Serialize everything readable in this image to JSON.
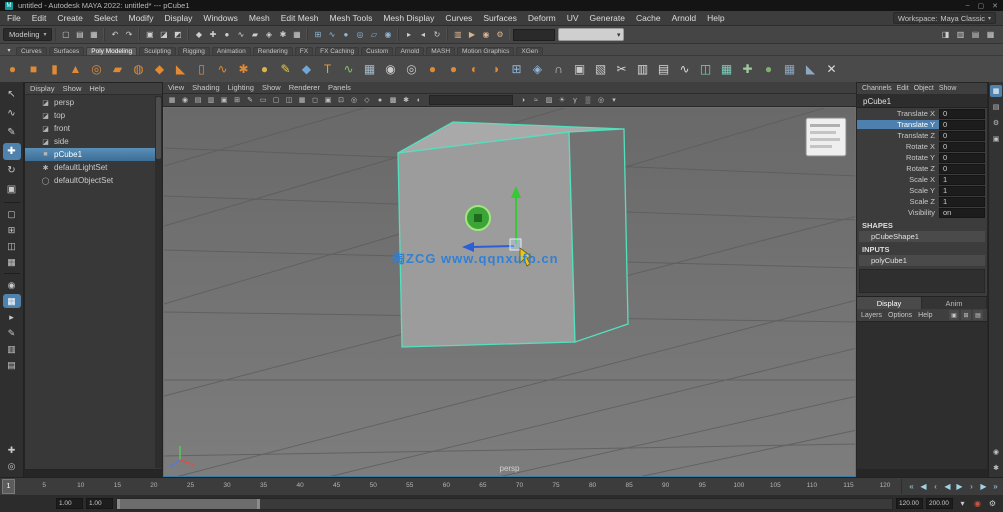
{
  "titlebar": {
    "title": "untitled - Autodesk MAYA 2022: untitled* --- pCube1",
    "controls": [
      {
        "n": "minimize-button",
        "g": "–"
      },
      {
        "n": "maximize-button",
        "g": "▢"
      },
      {
        "n": "close-button",
        "g": "✕"
      }
    ]
  },
  "menubar": {
    "items": [
      "File",
      "Edit",
      "Create",
      "Select",
      "Modify",
      "Display",
      "Windows",
      "Mesh",
      "Edit Mesh",
      "Mesh Tools",
      "Mesh Display",
      "Curves",
      "Surfaces",
      "Deform",
      "UV",
      "Generate",
      "Cache",
      "Arnold",
      "Help"
    ],
    "workspace_label": "Workspace:",
    "workspace_value": "Maya Classic"
  },
  "statusline": {
    "menuset": "Modeling",
    "groups": [
      {
        "icons": [
          {
            "n": "new-scene-icon",
            "g": "▢"
          },
          {
            "n": "open-scene-icon",
            "g": "▤"
          },
          {
            "n": "save-scene-icon",
            "g": "▦"
          }
        ]
      },
      {
        "icons": [
          {
            "n": "undo-icon",
            "g": "↶"
          },
          {
            "n": "redo-icon",
            "g": "↷"
          }
        ]
      },
      {
        "icons": [
          {
            "n": "hierarchy-mode-icon",
            "g": "▣"
          },
          {
            "n": "object-mode-icon",
            "g": "◪"
          },
          {
            "n": "component-mode-icon",
            "g": "◩"
          }
        ]
      },
      {
        "icons": [
          {
            "n": "select-all-mask-icon",
            "g": "◆"
          },
          {
            "n": "select-handles-mask-icon",
            "g": "✚"
          },
          {
            "n": "select-joints-mask-icon",
            "g": "●"
          },
          {
            "n": "select-curves-mask-icon",
            "g": "∿"
          },
          {
            "n": "select-surfaces-mask-icon",
            "g": "▰"
          },
          {
            "n": "select-deformations-mask-icon",
            "g": "◈"
          },
          {
            "n": "select-dynamics-mask-icon",
            "g": "✱"
          },
          {
            "n": "select-rendering-mask-icon",
            "g": "▦"
          }
        ]
      },
      {
        "icons": [
          {
            "n": "snap-grid-icon",
            "g": "⊞",
            "c": "#8fb8d8"
          },
          {
            "n": "snap-curve-icon",
            "g": "∿",
            "c": "#8fb8d8"
          },
          {
            "n": "snap-point-icon",
            "g": "●",
            "c": "#8fb8d8"
          },
          {
            "n": "snap-projected-center-icon",
            "g": "◎",
            "c": "#8fb8d8"
          },
          {
            "n": "snap-view-plane-icon",
            "g": "▱",
            "c": "#8fb8d8"
          },
          {
            "n": "make-live-icon",
            "g": "◉",
            "c": "#8fb8d8"
          }
        ]
      },
      {
        "icons": [
          {
            "n": "input-connections-icon",
            "g": "▸"
          },
          {
            "n": "output-connections-icon",
            "g": "◂"
          },
          {
            "n": "construction-history-icon",
            "g": "↻"
          }
        ]
      },
      {
        "icons": [
          {
            "n": "open-render-view-icon",
            "g": "▥",
            "c": "#d8b48f"
          },
          {
            "n": "render-current-frame-icon",
            "g": "▶",
            "c": "#d8b48f"
          },
          {
            "n": "ipr-render-icon",
            "g": "◉",
            "c": "#d8b48f"
          },
          {
            "n": "render-settings-icon",
            "g": "⚙",
            "c": "#d8b48f"
          }
        ]
      }
    ],
    "field_value": "",
    "toggles": [
      {
        "n": "modeling-toolkit-toggle-icon",
        "g": "◨"
      },
      {
        "n": "attribute-editor-toggle-icon",
        "g": "▥"
      },
      {
        "n": "tool-settings-toggle-icon",
        "g": "▤"
      },
      {
        "n": "channel-box-toggle-icon",
        "g": "▦"
      }
    ]
  },
  "shelf": {
    "tabs": [
      "Curves",
      "Surfaces",
      "Poly Modeling",
      "Sculpting",
      "Rigging",
      "Animation",
      "Rendering",
      "FX",
      "FX Caching",
      "Custom",
      "Arnold",
      "MASH",
      "Motion Graphics",
      "XGen"
    ],
    "active_tab": "Poly Modeling",
    "icons": [
      {
        "n": "poly-sphere-icon",
        "g": "●",
        "c": "#e08a35"
      },
      {
        "n": "poly-cube-icon",
        "g": "■",
        "c": "#e08a35"
      },
      {
        "n": "poly-cylinder-icon",
        "g": "▮",
        "c": "#e08a35"
      },
      {
        "n": "poly-cone-icon",
        "g": "▲",
        "c": "#e08a35"
      },
      {
        "n": "poly-torus-icon",
        "g": "◎",
        "c": "#e08a35"
      },
      {
        "n": "poly-plane-icon",
        "g": "▰",
        "c": "#e08a35"
      },
      {
        "n": "poly-disc-icon",
        "g": "◍",
        "c": "#e08a35"
      },
      {
        "n": "poly-platonic-icon",
        "g": "◆",
        "c": "#e08a35"
      },
      {
        "n": "poly-pyramid-icon",
        "g": "◣",
        "c": "#e08a35"
      },
      {
        "n": "poly-pipe-icon",
        "g": "▯",
        "c": "#e08a35"
      },
      {
        "n": "poly-helix-icon",
        "g": "∿",
        "c": "#e08a35"
      },
      {
        "n": "poly-gear-icon",
        "g": "✱",
        "c": "#e08a35"
      },
      {
        "n": "poly-soccerball-icon",
        "g": "●",
        "c": "#d8b44a"
      },
      {
        "n": "sculpt-pencil-icon",
        "g": "✎",
        "c": "#e5c94e"
      },
      {
        "n": "quad-draw-icon",
        "g": "◆",
        "c": "#6fa8d8"
      },
      {
        "n": "create-text-icon",
        "g": "T",
        "c": "#e0a040"
      },
      {
        "n": "sweep-mesh-icon",
        "g": "∿",
        "c": "#84c46a"
      },
      {
        "n": "uv-grid-icon",
        "g": "▦",
        "c": "#a8bccb"
      },
      {
        "n": "combine-icon",
        "g": "◉",
        "c": "#c9c9c9"
      },
      {
        "n": "separate-icon",
        "g": "◎",
        "c": "#c9c9c9"
      },
      {
        "n": "smooth-mesh-icon",
        "g": "●",
        "c": "#e08a35"
      },
      {
        "n": "boolean-union-icon",
        "g": "●",
        "c": "#e08a35"
      },
      {
        "n": "boolean-difference-icon",
        "g": "◐",
        "c": "#e08a35"
      },
      {
        "n": "boolean-intersection-icon",
        "g": "◑",
        "c": "#e08a35"
      },
      {
        "n": "extrude-icon",
        "g": "⊞",
        "c": "#8fb6d9"
      },
      {
        "n": "bevel-icon",
        "g": "◈",
        "c": "#8fb6d9"
      },
      {
        "n": "bridge-icon",
        "g": "∩",
        "c": "#c9c9c9"
      },
      {
        "n": "fill-hole-icon",
        "g": "▣",
        "c": "#c9c9c9"
      },
      {
        "n": "append-polygon-icon",
        "g": "▧",
        "c": "#c9c9c9"
      },
      {
        "n": "multi-cut-icon",
        "g": "✂",
        "c": "#d9d9d9"
      },
      {
        "n": "insert-edge-loop-icon",
        "g": "▥",
        "c": "#d9d9d9"
      },
      {
        "n": "offset-edge-loop-icon",
        "g": "▤",
        "c": "#d9d9d9"
      },
      {
        "n": "edit-edge-flow-icon",
        "g": "∿",
        "c": "#d9d9d9"
      },
      {
        "n": "mirror-icon",
        "g": "◫",
        "c": "#7fd0c0"
      },
      {
        "n": "symmetrize-icon",
        "g": "▦",
        "c": "#7fd0c0"
      },
      {
        "n": "average-vertices-icon",
        "g": "✚",
        "c": "#9fc9a0"
      },
      {
        "n": "sculpt-toolset-icon",
        "g": "●",
        "c": "#7fb070"
      },
      {
        "n": "quadrangulate-icon",
        "g": "▦",
        "c": "#8fa8c0"
      },
      {
        "n": "triangulate-icon",
        "g": "◣",
        "c": "#8fa8c0"
      },
      {
        "n": "delete-component-icon",
        "g": "✕",
        "c": "#d9d9d9"
      }
    ]
  },
  "toolbox": {
    "tools": [
      {
        "n": "select-tool-icon",
        "g": "↖"
      },
      {
        "n": "lasso-tool-icon",
        "g": "∿"
      },
      {
        "n": "paint-select-tool-icon",
        "g": "✎"
      },
      {
        "n": "move-tool-icon",
        "g": "✚",
        "active": true
      },
      {
        "n": "rotate-tool-icon",
        "g": "↻"
      },
      {
        "n": "scale-tool-icon",
        "g": "▣"
      }
    ],
    "layouts": [
      {
        "n": "single-pane-layout-icon",
        "g": "▢"
      },
      {
        "n": "four-pane-layout-icon",
        "g": "⊞"
      },
      {
        "n": "persp-outliner-layout-icon",
        "g": "◫"
      },
      {
        "n": "persp-graph-layout-icon",
        "g": "▦"
      }
    ],
    "panels": [
      {
        "n": "hypershade-icon",
        "g": "◉"
      },
      {
        "n": "uv-editor-icon",
        "g": "▦",
        "active": true
      },
      {
        "n": "node-editor-icon",
        "g": "▸"
      },
      {
        "n": "script-editor-icon",
        "g": "✎"
      },
      {
        "n": "render-view-panel-icon",
        "g": "▥"
      },
      {
        "n": "content-browser-icon",
        "g": "▤"
      }
    ],
    "bottom": [
      {
        "n": "show-manipulators-icon",
        "g": "✚"
      },
      {
        "n": "soft-select-icon",
        "g": "◎"
      }
    ]
  },
  "outliner": {
    "menus": [
      "Display",
      "Show",
      "Help"
    ],
    "items": [
      {
        "label": "persp",
        "g": "◪",
        "icon": "camera-icon",
        "selected": false
      },
      {
        "label": "top",
        "g": "◪",
        "icon": "camera-icon",
        "selected": false
      },
      {
        "label": "front",
        "g": "◪",
        "icon": "camera-icon",
        "selected": false
      },
      {
        "label": "side",
        "g": "◪",
        "icon": "camera-icon",
        "selected": false
      },
      {
        "label": "pCube1",
        "g": "■",
        "icon": "mesh-icon",
        "selected": true
      },
      {
        "label": "defaultLightSet",
        "g": "✱",
        "icon": "set-icon",
        "selected": false
      },
      {
        "label": "defaultObjectSet",
        "g": "◯",
        "icon": "set-icon",
        "selected": false
      }
    ]
  },
  "viewport": {
    "menus": [
      "View",
      "Shading",
      "Lighting",
      "Show",
      "Renderer",
      "Panels"
    ],
    "toolbar_left": [
      {
        "n": "select-camera-icon",
        "g": "▦"
      },
      {
        "n": "lock-camera-icon",
        "g": "◉"
      },
      {
        "n": "camera-attributes-icon",
        "g": "▤"
      },
      {
        "n": "bookmarks-icon",
        "g": "▥"
      },
      {
        "n": "image-plane-icon",
        "g": "▣"
      },
      {
        "n": "2d-pan-zoom-icon",
        "g": "⊞"
      },
      {
        "n": "grease-pencil-icon",
        "g": "✎"
      },
      {
        "n": "film-gate-icon",
        "g": "▭"
      },
      {
        "n": "resolution-gate-icon",
        "g": "▢"
      },
      {
        "n": "gate-mask-icon",
        "g": "◫"
      },
      {
        "n": "field-chart-icon",
        "g": "▦"
      },
      {
        "n": "safe-action-icon",
        "g": "◻"
      },
      {
        "n": "safe-title-icon",
        "g": "▣"
      },
      {
        "n": "frame-all-icon",
        "g": "⊡"
      },
      {
        "n": "frame-selection-icon",
        "g": "◎"
      },
      {
        "n": "wireframe-mode-icon",
        "g": "◇"
      },
      {
        "n": "smooth-shade-icon",
        "g": "●"
      },
      {
        "n": "textured-mode-icon",
        "g": "▩"
      },
      {
        "n": "lights-toggle-icon",
        "g": "✱"
      },
      {
        "n": "shadows-toggle-icon",
        "g": "◐"
      }
    ],
    "toolbar_right": [
      {
        "n": "screen-ao-icon",
        "g": "◑"
      },
      {
        "n": "motion-blur-icon",
        "g": "≈"
      },
      {
        "n": "anti-aliasing-icon",
        "g": "▨"
      },
      {
        "n": "exposure-icon",
        "g": "☀"
      },
      {
        "n": "gamma-icon",
        "g": "γ"
      },
      {
        "n": "xray-mode-icon",
        "g": "▒"
      },
      {
        "n": "isolate-select-icon",
        "g": "◎"
      },
      {
        "n": "viewport-renderer-icon",
        "g": "▾"
      }
    ],
    "camera_label": "persp",
    "watermark": "淘ZCG  www.qqnxufb.cn"
  },
  "channelbox": {
    "menus": [
      "Channels",
      "Edit",
      "Object",
      "Show"
    ],
    "object_name": "pCube1",
    "channels": [
      {
        "label": "Translate X",
        "value": "0",
        "selected": false
      },
      {
        "label": "Translate Y",
        "value": "0",
        "selected": true
      },
      {
        "label": "Translate Z",
        "value": "0",
        "selected": false
      },
      {
        "label": "Rotate X",
        "value": "0",
        "selected": false
      },
      {
        "label": "Rotate Y",
        "value": "0",
        "selected": false
      },
      {
        "label": "Rotate Z",
        "value": "0",
        "selected": false
      },
      {
        "label": "Scale X",
        "value": "1",
        "selected": false
      },
      {
        "label": "Scale Y",
        "value": "1",
        "selected": false
      },
      {
        "label": "Scale Z",
        "value": "1",
        "selected": false
      },
      {
        "label": "Visibility",
        "value": "on",
        "selected": false
      }
    ],
    "shapes_label": "SHAPES",
    "shape_name": "pCubeShape1",
    "inputs_label": "INPUTS",
    "input_name": "polyCube1"
  },
  "layereditor": {
    "tabs": [
      "Display",
      "Anim"
    ],
    "active_tab": "Display",
    "menus": [
      "Layers",
      "Options",
      "Help"
    ],
    "buttons": [
      {
        "n": "new-empty-layer-icon",
        "g": "▣"
      },
      {
        "n": "new-layer-from-selected-icon",
        "g": "⊞"
      },
      {
        "n": "move-objects-to-layer-icon",
        "g": "▤"
      }
    ]
  },
  "rightstrip": {
    "icons": [
      {
        "n": "channel-box-tab-icon",
        "g": "▦",
        "active": true
      },
      {
        "n": "attribute-editor-tab-icon",
        "g": "▤"
      },
      {
        "n": "tool-settings-tab-icon",
        "g": "⚙"
      },
      {
        "n": "modeling-toolkit-tab-icon",
        "g": "▣"
      },
      {
        "n": "character-controls-tab-icon",
        "g": "◉"
      },
      {
        "n": "xgen-tab-icon",
        "g": "✱"
      }
    ]
  },
  "timeline": {
    "current_frame": "1",
    "ticks": [
      5,
      10,
      15,
      20,
      25,
      30,
      35,
      40,
      45,
      50,
      55,
      60,
      65,
      70,
      75,
      80,
      85,
      90,
      95,
      100,
      105,
      110,
      115,
      120
    ],
    "playback": [
      {
        "n": "go-to-start-button",
        "g": "«"
      },
      {
        "n": "step-back-frame-button",
        "g": "◀"
      },
      {
        "n": "step-back-key-button",
        "g": "‹"
      },
      {
        "n": "play-backward-button",
        "g": "◀"
      },
      {
        "n": "play-forward-button",
        "g": "▶"
      },
      {
        "n": "step-forward-key-button",
        "g": "›"
      },
      {
        "n": "step-forward-frame-button",
        "g": "▶"
      },
      {
        "n": "go-to-end-button",
        "g": "»"
      }
    ]
  },
  "rangebar": {
    "anim_start": "1.00",
    "playback_start": "1.00",
    "playback_end": "120.00",
    "anim_end": "200.00",
    "buttons": [
      {
        "n": "character-set-menu-icon",
        "g": "▾"
      },
      {
        "n": "auto-key-button",
        "g": "◉",
        "c": "#cc5544"
      },
      {
        "n": "animation-preferences-icon",
        "g": "⚙"
      }
    ]
  }
}
